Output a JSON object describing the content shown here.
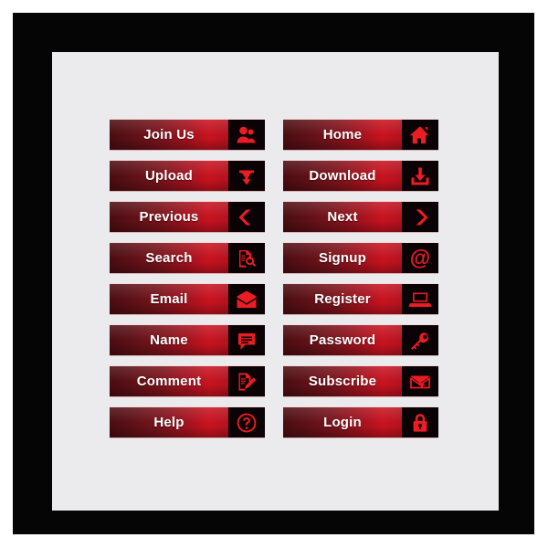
{
  "poster": {
    "background_color": "#ffffff",
    "frame_color": "#050505",
    "panel_color": "#ebebed"
  },
  "theme": {
    "accent_red": "#c8131f",
    "dark_red": "#4a0c11",
    "icon_panel": "#0a0204",
    "icon_red": "#ec1c24",
    "label_color": "#ffffff"
  },
  "columns": [
    {
      "name": "left-column",
      "buttons": [
        {
          "label": "Join Us",
          "icon": "users-icon"
        },
        {
          "label": "Upload",
          "icon": "upload-arrow-icon"
        },
        {
          "label": "Previous",
          "icon": "chevron-left-icon"
        },
        {
          "label": "Search",
          "icon": "document-magnifier-icon"
        },
        {
          "label": "Email",
          "icon": "envelope-open-icon"
        },
        {
          "label": "Name",
          "icon": "speech-bubble-icon"
        },
        {
          "label": "Comment",
          "icon": "document-pen-icon"
        },
        {
          "label": "Help",
          "icon": "question-circle-icon"
        }
      ]
    },
    {
      "name": "right-column",
      "buttons": [
        {
          "label": "Home",
          "icon": "home-icon"
        },
        {
          "label": "Download",
          "icon": "download-tray-icon"
        },
        {
          "label": "Next",
          "icon": "chevron-right-icon"
        },
        {
          "label": "Signup",
          "icon": "at-sign-icon"
        },
        {
          "label": "Register",
          "icon": "laptop-icon"
        },
        {
          "label": "Password",
          "icon": "key-icon"
        },
        {
          "label": "Subscribe",
          "icon": "envelope-cursor-icon"
        },
        {
          "label": "Login",
          "icon": "padlock-icon"
        }
      ]
    }
  ]
}
